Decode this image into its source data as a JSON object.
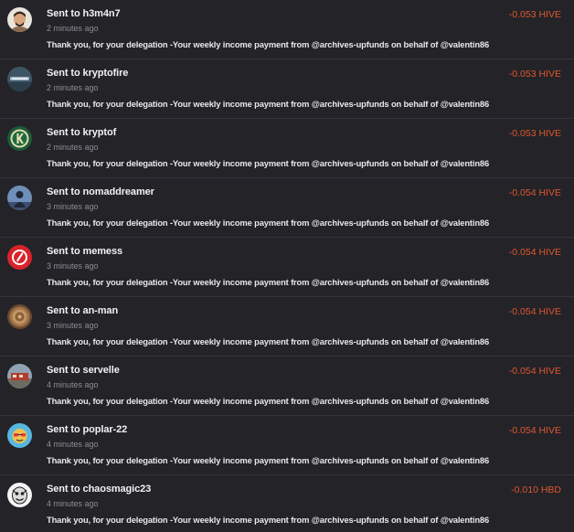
{
  "transfers": [
    {
      "prefix": "Sent to",
      "user": "h3m4n7",
      "time": "2 minutes ago",
      "memo": "Thank you, for your delegation -Your weekly income payment from @archives-upfunds on behalf of @valentin86",
      "amount": "-0.053 HIVE",
      "avatar": "avatar-h3m4n7"
    },
    {
      "prefix": "Sent to",
      "user": "kryptofire",
      "time": "2 minutes ago",
      "memo": "Thank you, for your delegation -Your weekly income payment from @archives-upfunds on behalf of @valentin86",
      "amount": "-0.053 HIVE",
      "avatar": "avatar-kryptofire"
    },
    {
      "prefix": "Sent to",
      "user": "kryptof",
      "time": "2 minutes ago",
      "memo": "Thank you, for your delegation -Your weekly income payment from @archives-upfunds on behalf of @valentin86",
      "amount": "-0.053 HIVE",
      "avatar": "avatar-kryptof"
    },
    {
      "prefix": "Sent to",
      "user": "nomaddreamer",
      "time": "3 minutes ago",
      "memo": "Thank you, for your delegation -Your weekly income payment from @archives-upfunds on behalf of @valentin86",
      "amount": "-0.054 HIVE",
      "avatar": "avatar-nomaddreamer"
    },
    {
      "prefix": "Sent to",
      "user": "memess",
      "time": "3 minutes ago",
      "memo": "Thank you, for your delegation -Your weekly income payment from @archives-upfunds on behalf of @valentin86",
      "amount": "-0.054 HIVE",
      "avatar": "avatar-memess"
    },
    {
      "prefix": "Sent to",
      "user": "an-man",
      "time": "3 minutes ago",
      "memo": "Thank you, for your delegation -Your weekly income payment from @archives-upfunds on behalf of @valentin86",
      "amount": "-0.054 HIVE",
      "avatar": "avatar-an-man"
    },
    {
      "prefix": "Sent to",
      "user": "servelle",
      "time": "4 minutes ago",
      "memo": "Thank you, for your delegation -Your weekly income payment from @archives-upfunds on behalf of @valentin86",
      "amount": "-0.054 HIVE",
      "avatar": "avatar-servelle"
    },
    {
      "prefix": "Sent to",
      "user": "poplar-22",
      "time": "4 minutes ago",
      "memo": "Thank you, for your delegation -Your weekly income payment from @archives-upfunds on behalf of @valentin86",
      "amount": "-0.054 HIVE",
      "avatar": "avatar-poplar-22"
    },
    {
      "prefix": "Sent to",
      "user": "chaosmagic23",
      "time": "4 minutes ago",
      "memo": "Thank you, for your delegation -Your weekly income payment from @archives-upfunds on behalf of @valentin86",
      "amount": "-0.010 HBD",
      "avatar": "avatar-chaosmagic23"
    }
  ],
  "colors": {
    "background": "#232328",
    "divider": "#34343a",
    "amount": "#e0572e",
    "title": "#f2f2f2",
    "time": "#8d8d93"
  }
}
